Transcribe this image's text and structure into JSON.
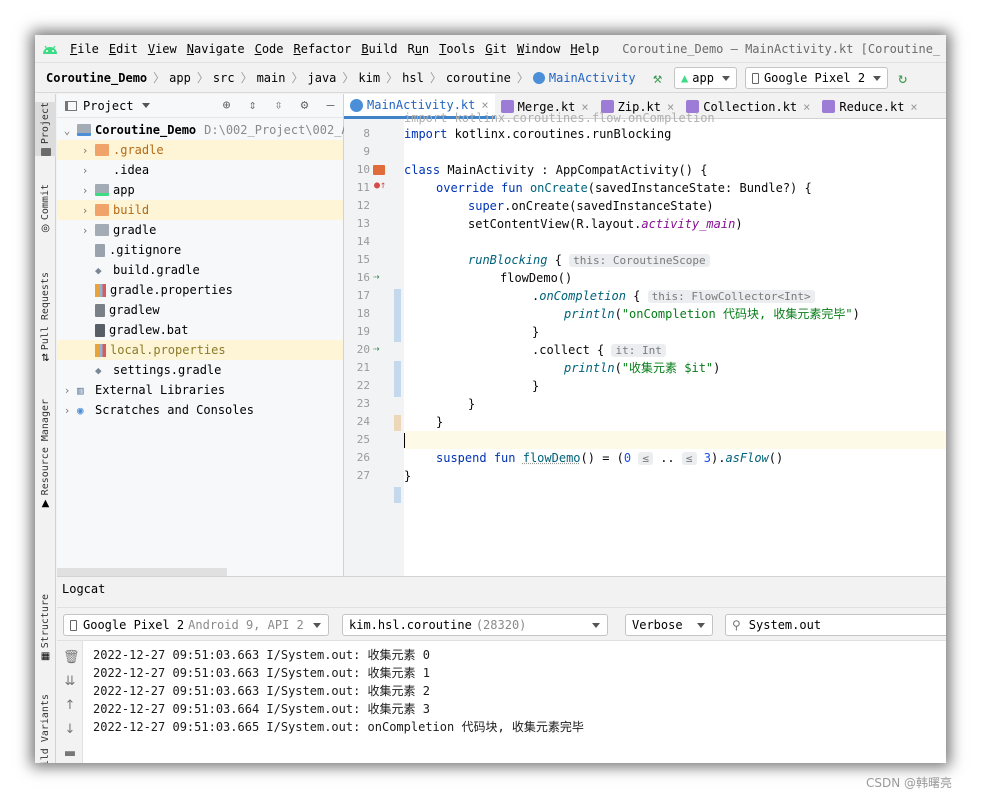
{
  "menubar": {
    "items": [
      "File",
      "Edit",
      "View",
      "Navigate",
      "Code",
      "Refactor",
      "Build",
      "Run",
      "Tools",
      "Git",
      "Window",
      "Help"
    ],
    "mnemonics": [
      "F",
      "E",
      "V",
      "N",
      "C",
      "R",
      "B",
      "u",
      "T",
      "G",
      "W",
      "H"
    ],
    "window_title": "Coroutine_Demo – MainActivity.kt [Coroutine_"
  },
  "breadcrumb": [
    "Coroutine_Demo",
    "app",
    "src",
    "main",
    "java",
    "kim",
    "hsl",
    "coroutine",
    "MainActivity"
  ],
  "toolbar": {
    "run_config": "app",
    "device": "Google Pixel 2"
  },
  "left_strip": [
    "Project",
    "Commit",
    "Pull Requests",
    "Resource Manager",
    "Structure",
    "Build Variants"
  ],
  "project": {
    "header": "Project",
    "root": {
      "name": "Coroutine_Demo",
      "path": "D:\\002_Project\\002_A"
    },
    "items": [
      {
        "label": ".gradle",
        "kind": "folder-orange",
        "expand": true
      },
      {
        "label": ".idea",
        "kind": "none",
        "expand": true
      },
      {
        "label": "app",
        "kind": "folder-module",
        "expand": true
      },
      {
        "label": "build",
        "kind": "folder-orange",
        "expand": true
      },
      {
        "label": "gradle",
        "kind": "folder",
        "expand": true
      },
      {
        "label": ".gitignore",
        "kind": "file-ignore",
        "expand": false
      },
      {
        "label": "build.gradle",
        "kind": "file-gradle",
        "expand": false
      },
      {
        "label": "gradle.properties",
        "kind": "file-props",
        "expand": false
      },
      {
        "label": "gradlew",
        "kind": "file",
        "expand": false
      },
      {
        "label": "gradlew.bat",
        "kind": "file-bat",
        "expand": false
      },
      {
        "label": "local.properties",
        "kind": "file-props-olive",
        "expand": false
      },
      {
        "label": "settings.gradle",
        "kind": "file-gradle",
        "expand": false
      }
    ],
    "external": "External Libraries",
    "scratches": "Scratches and Consoles"
  },
  "editor": {
    "tabs": [
      "MainActivity.kt",
      "Merge.kt",
      "Zip.kt",
      "Collection.kt",
      "Reduce.kt"
    ],
    "active_tab": 0,
    "line_numbers": [
      "8",
      "9",
      "10",
      "11",
      "12",
      "13",
      "14",
      "15",
      "16",
      "17",
      "18",
      "19",
      "20",
      "21",
      "22",
      "23",
      "24",
      "25",
      "26",
      "27"
    ],
    "code": {
      "l8_kw": "import",
      "l8_rest": " kotlinx.coroutines.runBlocking",
      "l10_kw": "class",
      "l10_rest": " MainActivity : AppCompatActivity() {",
      "l11_kw1": "override",
      "l11_kw2": "fun",
      "l11_fn": "onCreate",
      "l11_rest": "(savedInstanceState: Bundle?) {",
      "l12_kw": "super",
      "l12_rest": ".onCreate(savedInstanceState)",
      "l13_a": "setContentView(R.layout.",
      "l13_b": "activity_main",
      "l13_c": ")",
      "l15_fn": "runBlocking",
      "l15_rest": " {",
      "l15_hint": "this: CoroutineScope",
      "l16": "flowDemo()",
      "l17_a": ".",
      "l17_fn": "onCompletion",
      "l17_b": " {",
      "l17_hint": "this: FlowCollector<Int>",
      "l18_fn": "println",
      "l18_a": "(",
      "l18_str": "\"onCompletion 代码块, 收集元素完毕\"",
      "l18_b": ")",
      "l19": "}",
      "l20": ".collect {",
      "l20_hint": "it: Int",
      "l21_fn": "println",
      "l21_a": "(",
      "l21_str": "\"收集元素 $it\"",
      "l21_b": ")",
      "l22": "}",
      "l23": "}",
      "l24": "}",
      "l26_kw1": "suspend",
      "l26_kw2": "fun",
      "l26_fn": "flowDemo",
      "l26_a": "() = (",
      "l26_n0": "0",
      "l26_le1": "≤",
      "l26_dots": " .. ",
      "l26_le2": "≤",
      "l26_n3": "3",
      "l26_b": ").",
      "l26_fn2": "asFlow",
      "l26_c": "()",
      "l27": "}",
      "top_partial": "import kotlinx.coroutines.flow.onCompletion"
    }
  },
  "logcat": {
    "title": "Logcat",
    "device": "Google Pixel 2",
    "device_detail": "Android 9, API 2",
    "process": "kim.hsl.coroutine",
    "pid": "(28320)",
    "level": "Verbose",
    "filter": "System.out",
    "lines": [
      "2022-12-27 09:51:03.663 I/System.out: 收集元素 0",
      "2022-12-27 09:51:03.663 I/System.out: 收集元素 1",
      "2022-12-27 09:51:03.663 I/System.out: 收集元素 2",
      "2022-12-27 09:51:03.664 I/System.out: 收集元素 3",
      "2022-12-27 09:51:03.665 I/System.out: onCompletion 代码块, 收集元素完毕"
    ]
  },
  "watermark": "CSDN @韩曙亮",
  "colors": {
    "accent": "#4083c9",
    "keyword": "#0033b3",
    "string": "#067d17",
    "function": "#00627a",
    "orange_folder": "#f0a46a"
  }
}
